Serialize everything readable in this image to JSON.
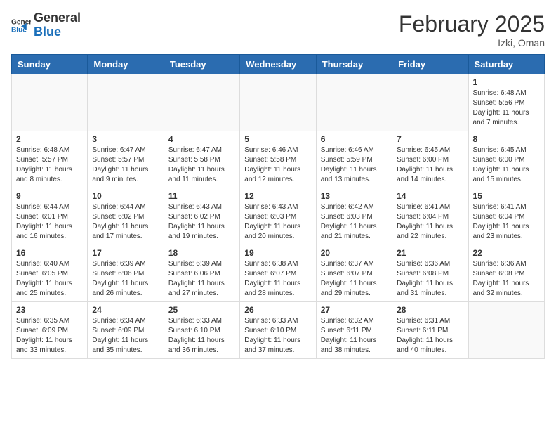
{
  "logo": {
    "general": "General",
    "blue": "Blue"
  },
  "title": "February 2025",
  "subtitle": "Izki, Oman",
  "weekdays": [
    "Sunday",
    "Monday",
    "Tuesday",
    "Wednesday",
    "Thursday",
    "Friday",
    "Saturday"
  ],
  "weeks": [
    [
      {
        "day": "",
        "info": ""
      },
      {
        "day": "",
        "info": ""
      },
      {
        "day": "",
        "info": ""
      },
      {
        "day": "",
        "info": ""
      },
      {
        "day": "",
        "info": ""
      },
      {
        "day": "",
        "info": ""
      },
      {
        "day": "1",
        "info": "Sunrise: 6:48 AM\nSunset: 5:56 PM\nDaylight: 11 hours\nand 7 minutes."
      }
    ],
    [
      {
        "day": "2",
        "info": "Sunrise: 6:48 AM\nSunset: 5:57 PM\nDaylight: 11 hours\nand 8 minutes."
      },
      {
        "day": "3",
        "info": "Sunrise: 6:47 AM\nSunset: 5:57 PM\nDaylight: 11 hours\nand 9 minutes."
      },
      {
        "day": "4",
        "info": "Sunrise: 6:47 AM\nSunset: 5:58 PM\nDaylight: 11 hours\nand 11 minutes."
      },
      {
        "day": "5",
        "info": "Sunrise: 6:46 AM\nSunset: 5:58 PM\nDaylight: 11 hours\nand 12 minutes."
      },
      {
        "day": "6",
        "info": "Sunrise: 6:46 AM\nSunset: 5:59 PM\nDaylight: 11 hours\nand 13 minutes."
      },
      {
        "day": "7",
        "info": "Sunrise: 6:45 AM\nSunset: 6:00 PM\nDaylight: 11 hours\nand 14 minutes."
      },
      {
        "day": "8",
        "info": "Sunrise: 6:45 AM\nSunset: 6:00 PM\nDaylight: 11 hours\nand 15 minutes."
      }
    ],
    [
      {
        "day": "9",
        "info": "Sunrise: 6:44 AM\nSunset: 6:01 PM\nDaylight: 11 hours\nand 16 minutes."
      },
      {
        "day": "10",
        "info": "Sunrise: 6:44 AM\nSunset: 6:02 PM\nDaylight: 11 hours\nand 17 minutes."
      },
      {
        "day": "11",
        "info": "Sunrise: 6:43 AM\nSunset: 6:02 PM\nDaylight: 11 hours\nand 19 minutes."
      },
      {
        "day": "12",
        "info": "Sunrise: 6:43 AM\nSunset: 6:03 PM\nDaylight: 11 hours\nand 20 minutes."
      },
      {
        "day": "13",
        "info": "Sunrise: 6:42 AM\nSunset: 6:03 PM\nDaylight: 11 hours\nand 21 minutes."
      },
      {
        "day": "14",
        "info": "Sunrise: 6:41 AM\nSunset: 6:04 PM\nDaylight: 11 hours\nand 22 minutes."
      },
      {
        "day": "15",
        "info": "Sunrise: 6:41 AM\nSunset: 6:04 PM\nDaylight: 11 hours\nand 23 minutes."
      }
    ],
    [
      {
        "day": "16",
        "info": "Sunrise: 6:40 AM\nSunset: 6:05 PM\nDaylight: 11 hours\nand 25 minutes."
      },
      {
        "day": "17",
        "info": "Sunrise: 6:39 AM\nSunset: 6:06 PM\nDaylight: 11 hours\nand 26 minutes."
      },
      {
        "day": "18",
        "info": "Sunrise: 6:39 AM\nSunset: 6:06 PM\nDaylight: 11 hours\nand 27 minutes."
      },
      {
        "day": "19",
        "info": "Sunrise: 6:38 AM\nSunset: 6:07 PM\nDaylight: 11 hours\nand 28 minutes."
      },
      {
        "day": "20",
        "info": "Sunrise: 6:37 AM\nSunset: 6:07 PM\nDaylight: 11 hours\nand 29 minutes."
      },
      {
        "day": "21",
        "info": "Sunrise: 6:36 AM\nSunset: 6:08 PM\nDaylight: 11 hours\nand 31 minutes."
      },
      {
        "day": "22",
        "info": "Sunrise: 6:36 AM\nSunset: 6:08 PM\nDaylight: 11 hours\nand 32 minutes."
      }
    ],
    [
      {
        "day": "23",
        "info": "Sunrise: 6:35 AM\nSunset: 6:09 PM\nDaylight: 11 hours\nand 33 minutes."
      },
      {
        "day": "24",
        "info": "Sunrise: 6:34 AM\nSunset: 6:09 PM\nDaylight: 11 hours\nand 35 minutes."
      },
      {
        "day": "25",
        "info": "Sunrise: 6:33 AM\nSunset: 6:10 PM\nDaylight: 11 hours\nand 36 minutes."
      },
      {
        "day": "26",
        "info": "Sunrise: 6:33 AM\nSunset: 6:10 PM\nDaylight: 11 hours\nand 37 minutes."
      },
      {
        "day": "27",
        "info": "Sunrise: 6:32 AM\nSunset: 6:11 PM\nDaylight: 11 hours\nand 38 minutes."
      },
      {
        "day": "28",
        "info": "Sunrise: 6:31 AM\nSunset: 6:11 PM\nDaylight: 11 hours\nand 40 minutes."
      },
      {
        "day": "",
        "info": ""
      }
    ]
  ]
}
